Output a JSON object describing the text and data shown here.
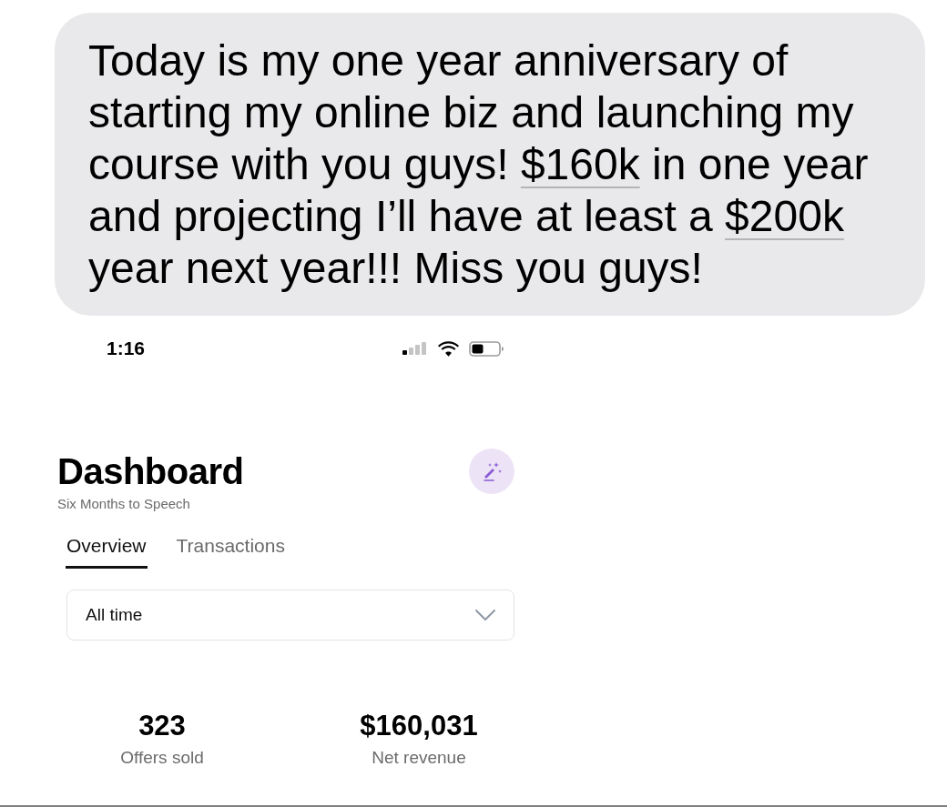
{
  "message": {
    "segments": [
      {
        "kind": "text",
        "text": "Today is my one year anniversary of starting my online biz and launching my course with you guys! "
      },
      {
        "kind": "link",
        "text": "$160k"
      },
      {
        "kind": "text",
        "text": " in one year and projecting I’ll have at least a "
      },
      {
        "kind": "link",
        "text": "$200k"
      },
      {
        "kind": "text",
        "text": " year next year!!! Miss you guys!"
      }
    ]
  },
  "status_bar": {
    "time": "1:16"
  },
  "header": {
    "title": "Dashboard",
    "subtitle": "Six Months to Speech"
  },
  "tabs": [
    {
      "label": "Overview",
      "selected": true
    },
    {
      "label": "Transactions",
      "selected": false
    }
  ],
  "period_select": {
    "value": "All time"
  },
  "stats": [
    {
      "value": "323",
      "label": "Offers sold"
    },
    {
      "value": "$160,031",
      "label": "Net revenue"
    }
  ]
}
